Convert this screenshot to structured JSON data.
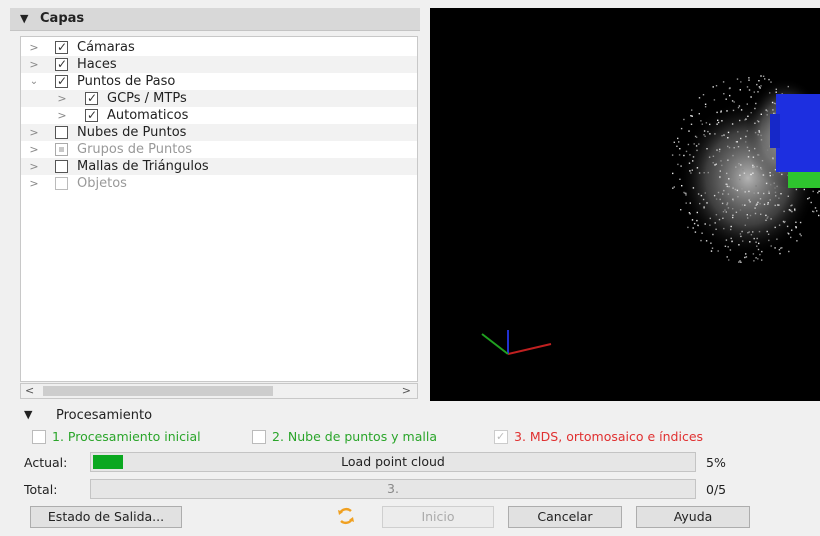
{
  "layers": {
    "title": "Capas",
    "items": [
      {
        "label": "Cámaras",
        "expanded": false,
        "checked": true,
        "enabled": true
      },
      {
        "label": "Haces",
        "expanded": false,
        "checked": true,
        "enabled": true
      },
      {
        "label": "Puntos de Paso",
        "expanded": true,
        "checked": true,
        "enabled": true
      },
      {
        "label": "GCPs / MTPs",
        "expanded": false,
        "checked": true,
        "enabled": true
      },
      {
        "label": "Automaticos",
        "expanded": false,
        "checked": true,
        "enabled": true
      },
      {
        "label": "Nubes de Puntos",
        "expanded": false,
        "checked": false,
        "enabled": true
      },
      {
        "label": "Grupos de Puntos",
        "expanded": false,
        "checked": false,
        "enabled": false
      },
      {
        "label": "Mallas de Triángulos",
        "expanded": false,
        "checked": false,
        "enabled": true
      },
      {
        "label": "Objetos",
        "expanded": false,
        "checked": false,
        "enabled": false
      }
    ],
    "scroll_left": "<",
    "scroll_right": ">"
  },
  "processing": {
    "title": "Procesamiento",
    "steps": [
      {
        "label": "1. Procesamiento inicial",
        "color": "#2aa52a",
        "checked": false
      },
      {
        "label": "2. Nube de puntos y malla",
        "color": "#2aa52a",
        "checked": false
      },
      {
        "label": "3. MDS, ortomosaico e índices",
        "color": "#e03030",
        "checked": true
      }
    ],
    "current": {
      "label": "Actual:",
      "text": "Load point cloud",
      "percent_text": "5%",
      "progress": 0.05
    },
    "total": {
      "label": "Total:",
      "text": "3.",
      "count_text": "0/5"
    },
    "buttons": {
      "output_status": "Estado de Salida...",
      "start": "Inicio",
      "cancel": "Cancelar",
      "help": "Ayuda"
    }
  },
  "colors": {
    "progress_fill": "#0aa820",
    "viewer_background": "#000000",
    "accent_refresh": "#f0a020"
  }
}
